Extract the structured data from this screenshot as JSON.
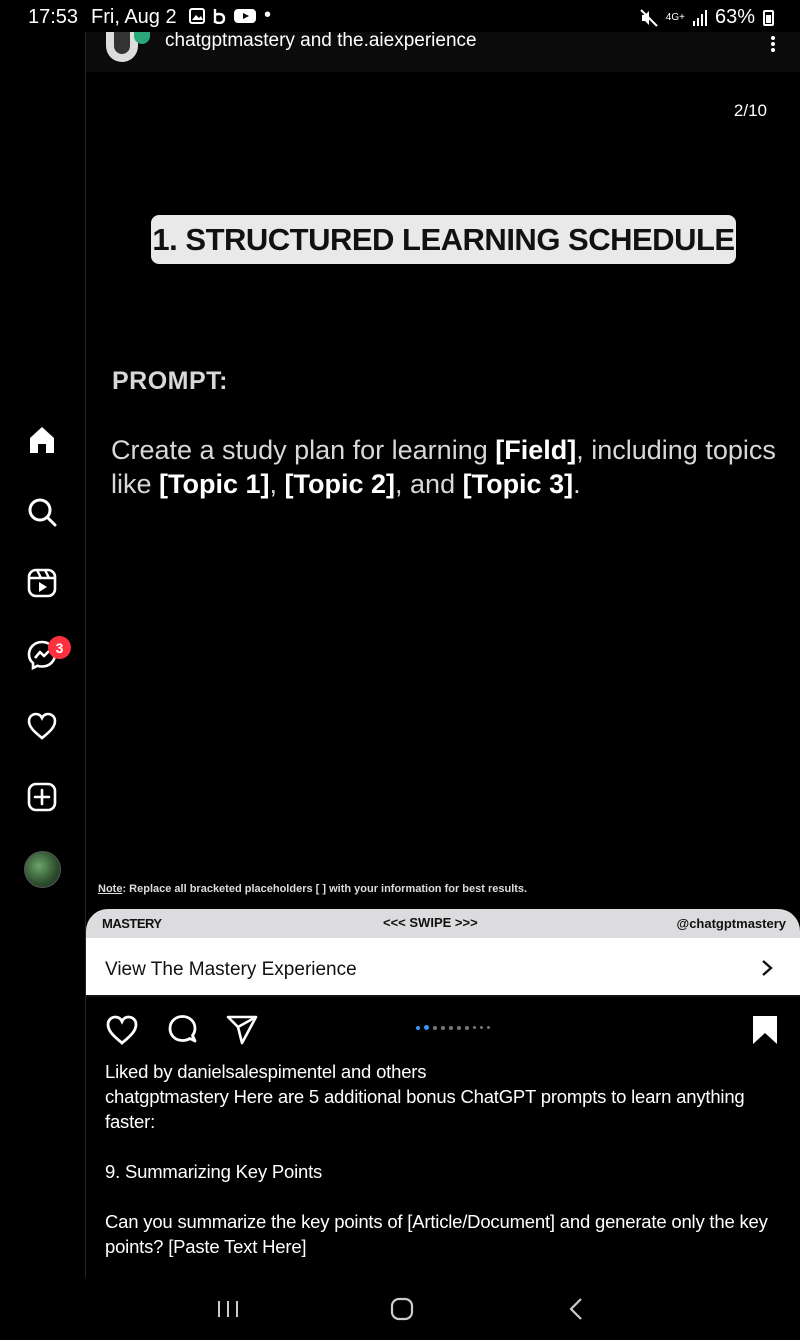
{
  "status_bar": {
    "time": "17:53",
    "date": "Fri, Aug 2",
    "dot": "•",
    "network": "4G+",
    "battery": "63%",
    "icons": [
      "gallery-icon",
      "b-icon",
      "youtube-icon",
      "mute-icon",
      "signal-icon",
      "battery-icon"
    ]
  },
  "nav_rail": {
    "items": [
      "home-icon",
      "search-icon",
      "reels-icon",
      "messenger-icon",
      "heart-icon",
      "create-icon",
      "profile-avatar"
    ],
    "messenger_badge": "3"
  },
  "post": {
    "username": "chatgptmastery and the.aiexperience",
    "slide": {
      "counter": "2/10",
      "title": "1. STRUCTURED LEARNING SCHEDULE",
      "prompt_label": "PROMPT:",
      "prompt_parts": {
        "p1": "Create a study plan for learning ",
        "b1": "[Field]",
        "p2": ", including topics like ",
        "b2": "[Topic 1]",
        "p3": ", ",
        "b3": "[Topic 2]",
        "p4": ", and ",
        "b4": "[Topic 3]",
        "p5": "."
      },
      "note_label": "Note",
      "note_text": ": Replace all bracketed placeholders [ ] with your information for best results.",
      "band_left": "MASTERY",
      "band_mid": "<<< SWIPE >>>",
      "band_right": "@chatgptmastery"
    },
    "cta_label": "View The Mastery Experience",
    "carousel": {
      "total": 10,
      "current": 2
    },
    "liked_by": "Liked by danielsalespimentel and others",
    "caption_lines": [
      "chatgptmastery Here are 5 additional bonus ChatGPT prompts to learn anything faster:",
      "9. Summarizing Key Points",
      "Can you summarize the key points of [Article/Document] and generate only the key points? [Paste Text Here]"
    ]
  },
  "colors": {
    "accent": "#3897f0",
    "badge": "#ff3040",
    "pill": "#e9e9ea"
  }
}
